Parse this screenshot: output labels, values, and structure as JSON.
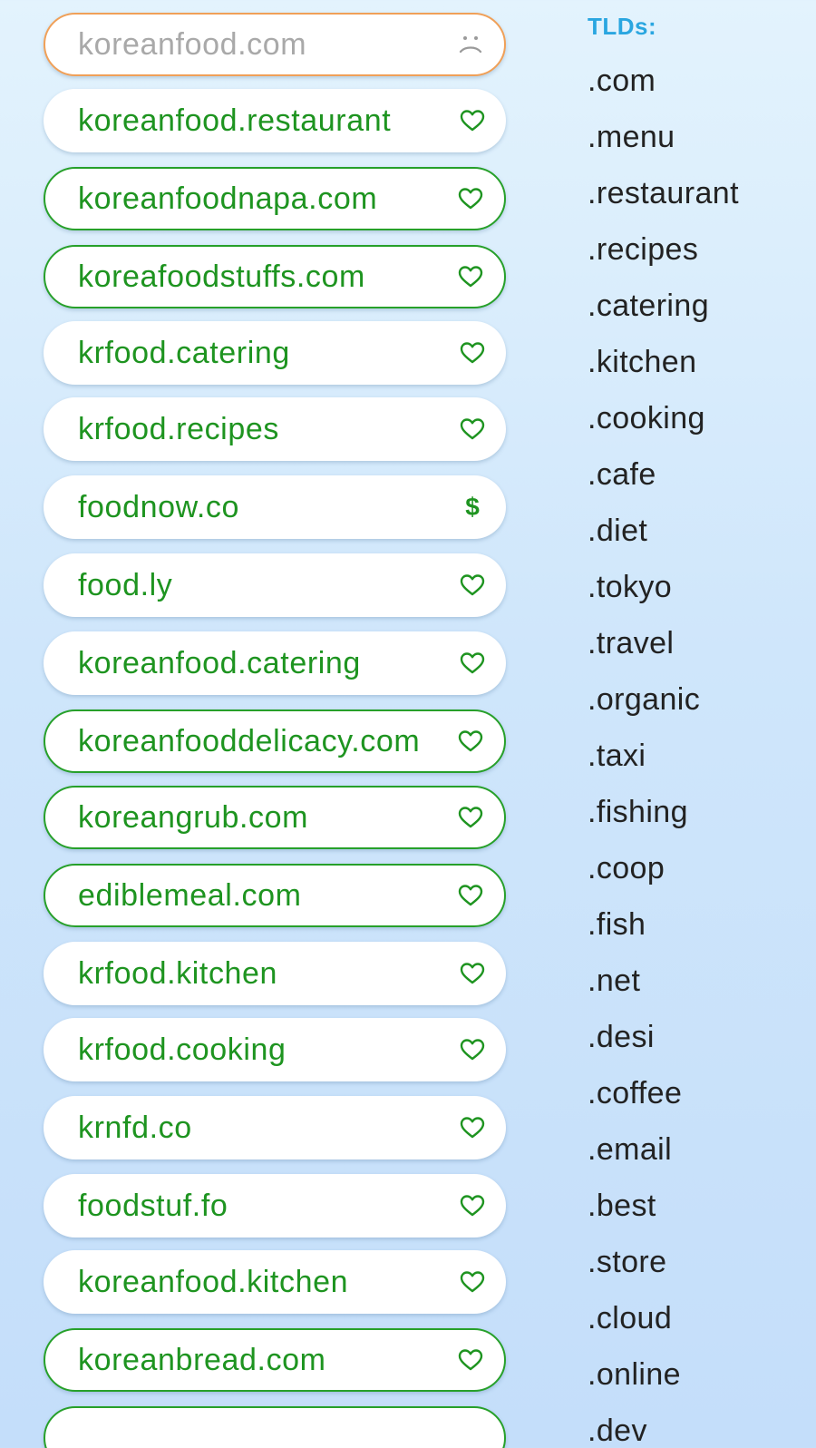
{
  "domains": [
    {
      "name": "koreanfood.com",
      "status": "taken",
      "icon": "sad-face-icon"
    },
    {
      "name": "koreanfood.restaurant",
      "status": "available",
      "icon": "heart-icon"
    },
    {
      "name": "koreanfoodnapa.com",
      "status": "available-outlined",
      "icon": "heart-icon"
    },
    {
      "name": "koreafoodstuffs.com",
      "status": "available-outlined",
      "icon": "heart-icon"
    },
    {
      "name": "krfood.catering",
      "status": "available",
      "icon": "heart-icon"
    },
    {
      "name": "krfood.recipes",
      "status": "available",
      "icon": "heart-icon"
    },
    {
      "name": "foodnow.co",
      "status": "for-sale",
      "icon": "dollar-icon",
      "icon_glyph": "$"
    },
    {
      "name": "food.ly",
      "status": "available",
      "icon": "heart-icon"
    },
    {
      "name": "koreanfood.catering",
      "status": "available",
      "icon": "heart-icon"
    },
    {
      "name": "koreanfooddelicacy.com",
      "status": "available-outlined",
      "icon": "heart-icon"
    },
    {
      "name": "koreangrub.com",
      "status": "available-outlined",
      "icon": "heart-icon"
    },
    {
      "name": "ediblemeal.com",
      "status": "available-outlined",
      "icon": "heart-icon"
    },
    {
      "name": "krfood.kitchen",
      "status": "available",
      "icon": "heart-icon"
    },
    {
      "name": "krfood.cooking",
      "status": "available",
      "icon": "heart-icon"
    },
    {
      "name": "krnfd.co",
      "status": "available",
      "icon": "heart-icon"
    },
    {
      "name": "foodstuf.fo",
      "status": "available",
      "icon": "heart-icon"
    },
    {
      "name": "koreanfood.kitchen",
      "status": "available",
      "icon": "heart-icon"
    },
    {
      "name": "koreanbread.com",
      "status": "available-outlined",
      "icon": "heart-icon"
    },
    {
      "name": "",
      "status": "available-outlined",
      "icon": ""
    }
  ],
  "tld_panel": {
    "heading": "TLDs:",
    "items": [
      ".com",
      ".menu",
      ".restaurant",
      ".recipes",
      ".catering",
      ".kitchen",
      ".cooking",
      ".cafe",
      ".diet",
      ".tokyo",
      ".travel",
      ".organic",
      ".taxi",
      ".fishing",
      ".coop",
      ".fish",
      ".net",
      ".desi",
      ".coffee",
      ".email",
      ".best",
      ".store",
      ".cloud",
      ".online",
      ".dev"
    ]
  },
  "colors": {
    "available_text": "#1e9420",
    "taken_text": "#a9a9a9",
    "taken_border": "#f0a058",
    "outline_border": "#27a02a",
    "tld_heading": "#2aa6e0",
    "tld_text": "#222222"
  }
}
